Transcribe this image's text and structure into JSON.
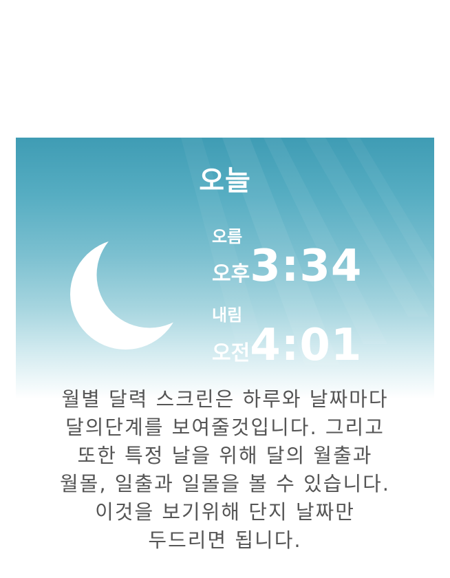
{
  "screen": {
    "title": "오늘",
    "moon_icon": "crescent-moon-icon",
    "rise": {
      "label": "오름",
      "ampm": "오후",
      "time": "3:34"
    },
    "set": {
      "label": "내림",
      "ampm": "오전",
      "time": "4:01"
    },
    "colors": {
      "sky_top": "#3f9cb4",
      "text": "#ffffff"
    }
  },
  "description": {
    "lines": [
      "월별 달력 스크린은 하루와 날짜마다",
      "달의단계를 보여줄것입니다. 그리고",
      "또한 특정 날을 위해 달의 월출과",
      "월몰, 일출과 일몰을 볼 수 있습니다.",
      "이것을 보기위해 단지 날짜만",
      "두드리면 됩니다."
    ],
    "color": "#555555"
  }
}
